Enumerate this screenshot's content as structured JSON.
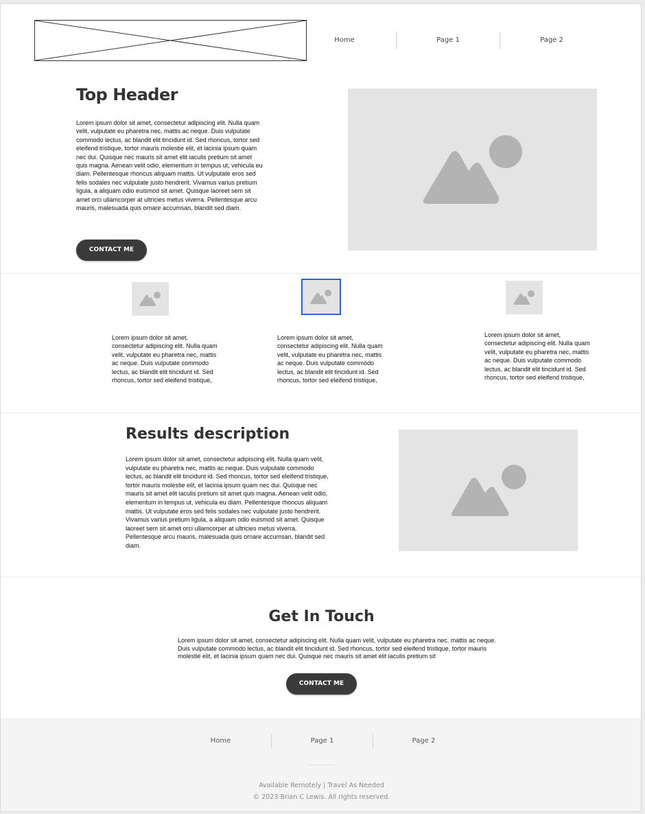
{
  "nav": {
    "items": [
      "Home",
      "Page 1",
      "Page 2"
    ]
  },
  "hero": {
    "title": "Top Header",
    "body": "Lorem ipsum dolor sit amet, consectetur adipiscing elit. Nulla quam velit, vulputate eu pharetra nec, mattis ac neque. Duis vulputate commodo lectus, ac blandit elit tincidunt id. Sed rhoncus, tortor sed eleifend tristique, tortor mauris molestie elit, et lacinia ipsum quam nec dui. Quisque nec mauris sit amet elit iaculis pretium sit amet quis magna. Aenean velit odio, elementum in tempus ut, vehicula eu diam. Pellentesque rhoncus aliquam mattis. Ut vulputate eros sed felis sodales nec vulputate justo hendrerit. Vivamus varius pretium ligula, a aliquam odio euismod sit amet. Quisque laoreet sem sit amet orci ullamcorper at ultricies metus viverra. Pellentesque arcu mauris, malesuada quis ornare accumsan, blandit sed diam.",
    "button": "CONTACT ME"
  },
  "features": [
    {
      "text": "Lorem ipsum dolor sit amet, consectetur adipiscing elit. Nulla quam velit, vulputate eu pharetra nec, mattis ac neque. Duis vulputate commodo lectus, ac blandit elit tincidunt id. Sed rhoncus, tortor sed eleifend tristique, tortor mauris"
    },
    {
      "text": "Lorem ipsum dolor sit amet, consectetur adipiscing elit. Nulla quam velit, vulputate eu pharetra nec, mattis ac neque. Duis vulputate commodo lectus, ac blandit elit tincidunt id. Sed rhoncus, tortor sed eleifend tristique, tortor mauris"
    },
    {
      "text": "Lorem ipsum dolor sit amet, consectetur adipiscing elit. Nulla quam velit, vulputate eu pharetra nec, mattis ac neque. Duis vulputate commodo lectus, ac blandit elit tincidunt id. Sed rhoncus, tortor sed eleifend tristique, tortor mauris"
    }
  ],
  "results": {
    "title": "Results description",
    "body": "Lorem ipsum dolor sit amet, consectetur adipiscing elit. Nulla quam velit, vulputate eu pharetra nec, mattis ac neque. Duis vulputate commodo lectus, ac blandit elit tincidunt id. Sed rhoncus, tortor sed eleifend tristique, tortor mauris molestie elit, et lacinia ipsum quam nec dui. Quisque nec mauris sit amet elit iaculis pretium sit amet quis magna. Aenean velit odio, elementum in tempus ut, vehicula eu diam. Pellentesque rhoncus aliquam mattis. Ut vulputate eros sed felis sodales nec vulputate justo hendrerit. Vivamus varius pretium ligula, a aliquam odio euismod sit amet. Quisque laoreet sem sit amet orci ullamcorper at ultricies metus viverra. Pellentesque arcu mauris, malesuada quis ornare accumsan, blandit sed diam."
  },
  "contact": {
    "title": "Get In Touch",
    "body": "Lorem ipsum dolor sit amet, consectetur adipiscing elit. Nulla quam velit, vulputate eu pharetra nec, mattis ac neque. Duis vulputate commodo lectus, ac blandit elit tincidunt id. Sed rhoncus, tortor sed eleifend tristique, tortor mauris molestie elit, et lacinia ipsum quam nec dui. Quisque nec mauris sit amet elit iaculis pretium sit",
    "button": "CONTACT ME"
  },
  "footer": {
    "nav": [
      "Home",
      "Page 1",
      "Page 2"
    ],
    "tagline": "Available Remotely | Travel As Needed",
    "copyright": "© 2023 Brian C Lewis.  All rights reserved."
  },
  "colors": {
    "button_bg": "#3a3a3a",
    "placeholder_bg": "#e4e4e4",
    "placeholder_icon": "#b3b3b3",
    "selection_outline": "#2a64d9",
    "footer_bg": "#f4f4f4"
  },
  "icons": {
    "logo": "logo-placeholder-cross",
    "image": "image-placeholder-icon"
  }
}
